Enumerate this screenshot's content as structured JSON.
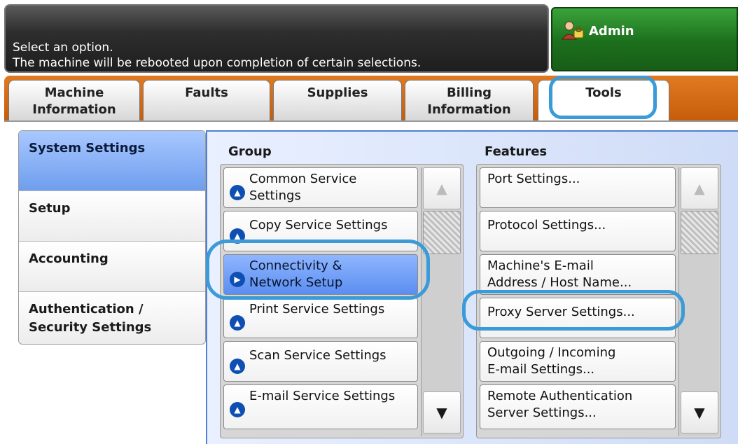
{
  "header": {
    "message_line1": "Select an option.",
    "message_line2": "The machine will be rebooted upon completion of certain selections.",
    "admin_label": "Admin"
  },
  "tabs": [
    {
      "label_line1": "Machine",
      "label_line2": "Information"
    },
    {
      "label_line1": "Faults",
      "label_line2": ""
    },
    {
      "label_line1": "Supplies",
      "label_line2": ""
    },
    {
      "label_line1": "Billing",
      "label_line2": "Information"
    },
    {
      "label_line1": "Tools",
      "label_line2": ""
    }
  ],
  "active_tab": "Tools",
  "sidebar": {
    "items": [
      {
        "line1": "System Settings",
        "line2": ""
      },
      {
        "line1": "Setup",
        "line2": ""
      },
      {
        "line1": "Accounting",
        "line2": ""
      },
      {
        "line1": "Authentication /",
        "line2": "Security Settings"
      }
    ],
    "selected": "System Settings"
  },
  "group": {
    "header": "Group",
    "items": [
      {
        "line1": "Common Service",
        "line2": "Settings"
      },
      {
        "line1": "Copy Service Settings",
        "line2": ""
      },
      {
        "line1": "Connectivity &",
        "line2": "Network Setup"
      },
      {
        "line1": "Print Service Settings",
        "line2": ""
      },
      {
        "line1": "Scan Service Settings",
        "line2": ""
      },
      {
        "line1": "E-mail Service Settings",
        "line2": ""
      }
    ],
    "selected": "Connectivity & Network Setup"
  },
  "features": {
    "header": "Features",
    "items": [
      {
        "line1": "Port Settings...",
        "line2": ""
      },
      {
        "line1": "Protocol Settings...",
        "line2": ""
      },
      {
        "line1": "Machine's E-mail",
        "line2": "Address / Host Name..."
      },
      {
        "line1": "Proxy Server Settings...",
        "line2": ""
      },
      {
        "line1": "Outgoing / Incoming",
        "line2": "E-mail Settings..."
      },
      {
        "line1": "Remote Authentication",
        "line2": "Server Settings..."
      }
    ]
  },
  "scroll": {
    "up_glyph": "▲",
    "down_glyph": "▼"
  },
  "colors": {
    "tab_strip": "#d46a14",
    "admin_green": "#1c6f1c",
    "selection_blue": "#5b8ef0",
    "callout_blue": "#3a9bd8"
  }
}
